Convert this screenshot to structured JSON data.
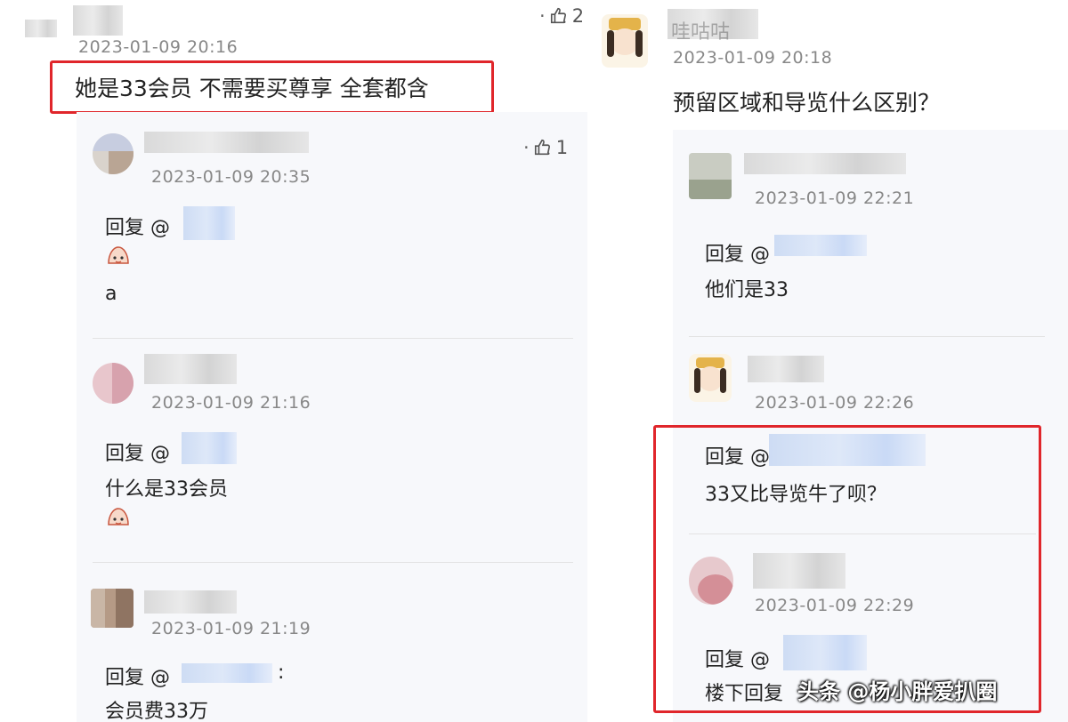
{
  "colors": {
    "accent_red": "#e0262b",
    "timestamp_gray": "#888888",
    "panel_bg": "#f7f8fb",
    "mention_blur": "#c9d9f3"
  },
  "left": {
    "main": {
      "timestamp": "2023-01-09 20:16",
      "text": "她是33会员 不需要买尊享 全套都含",
      "likes": "2",
      "like_icon": "thumb-up-icon"
    },
    "replies": [
      {
        "timestamp": "2023-01-09 20:35",
        "reply_prefix": "回复 @",
        "mention_tail": "",
        "emoji": "bun-face-emoji",
        "text": "a",
        "likes": "1"
      },
      {
        "timestamp": "2023-01-09 21:16",
        "reply_prefix": "回复 @",
        "mention_tail": "",
        "text": "什么是33会员",
        "emoji": "bun-face-emoji"
      },
      {
        "timestamp": "2023-01-09 21:19",
        "reply_prefix": "回复 @",
        "mention_tail": ":",
        "text": "会员费33万"
      }
    ]
  },
  "right": {
    "main": {
      "username": "哇咕咕",
      "timestamp": "2023-01-09 20:18",
      "text": "预留区域和导览什么区别？"
    },
    "replies": [
      {
        "timestamp": "2023-01-09 22:21",
        "reply_prefix": "回复 @",
        "text": "他们是33"
      },
      {
        "timestamp": "2023-01-09 22:26",
        "reply_prefix": "回复 @",
        "text": "33又比导览牛了呗？"
      },
      {
        "timestamp": "2023-01-09 22:29",
        "reply_prefix": "回复 @",
        "text": "楼下回复"
      }
    ]
  },
  "watermark": "头条 @杨小胖爱扒圈"
}
